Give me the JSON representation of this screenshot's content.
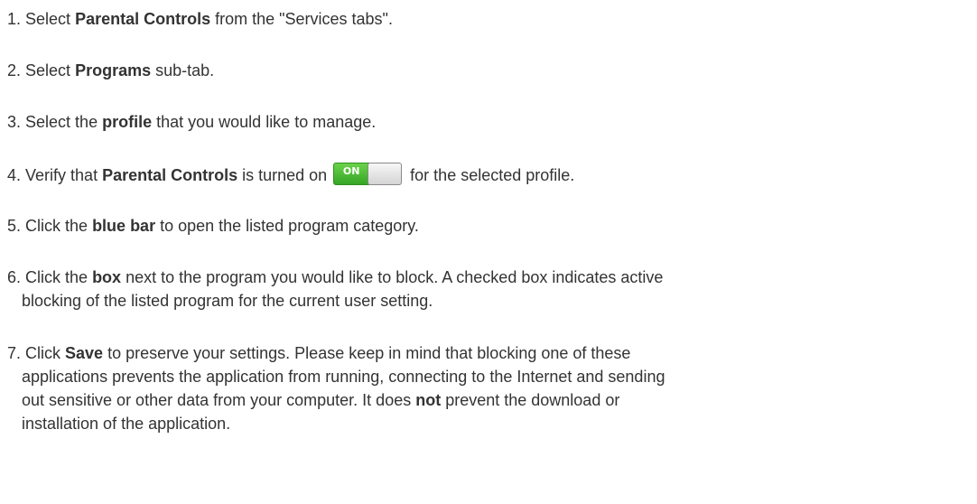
{
  "steps": [
    {
      "num": "1.",
      "a": "Select ",
      "b": "Parental Controls",
      "c": " from the \"Services tabs\"."
    },
    {
      "num": "2.",
      "a": "Select ",
      "b": "Programs",
      "c": " sub-tab."
    },
    {
      "num": "3.",
      "a": "Select the ",
      "b": "profile",
      "c": " that you would like to manage."
    },
    {
      "num": "4.",
      "a": "Verify that ",
      "b": "Parental Controls",
      "c": " is turned on ",
      "toggle_label": "ON",
      "d": " for the selected profile."
    },
    {
      "num": "5.",
      "a": "Click the ",
      "b": "blue bar",
      "c": " to open the listed program category."
    },
    {
      "num": "6.",
      "a": "Click the ",
      "b": "box",
      "c": " next to the program you would like to block. A checked box indicates active",
      "line2": "blocking of the listed program for the current user setting."
    },
    {
      "num": "7.",
      "a": "Click ",
      "b": "Save",
      "c": " to preserve your settings. Please keep in mind that blocking one of these",
      "line2": "applications prevents the application from running, connecting to the Internet and sending",
      "line3a": "out sensitive or other data from your computer. It does ",
      "line3b": "not",
      "line3c": " prevent the download or",
      "line4": "installation of the application."
    }
  ],
  "colors": {
    "text": "#333333",
    "toggle_on": "#35a626",
    "background": "#ffffff"
  }
}
